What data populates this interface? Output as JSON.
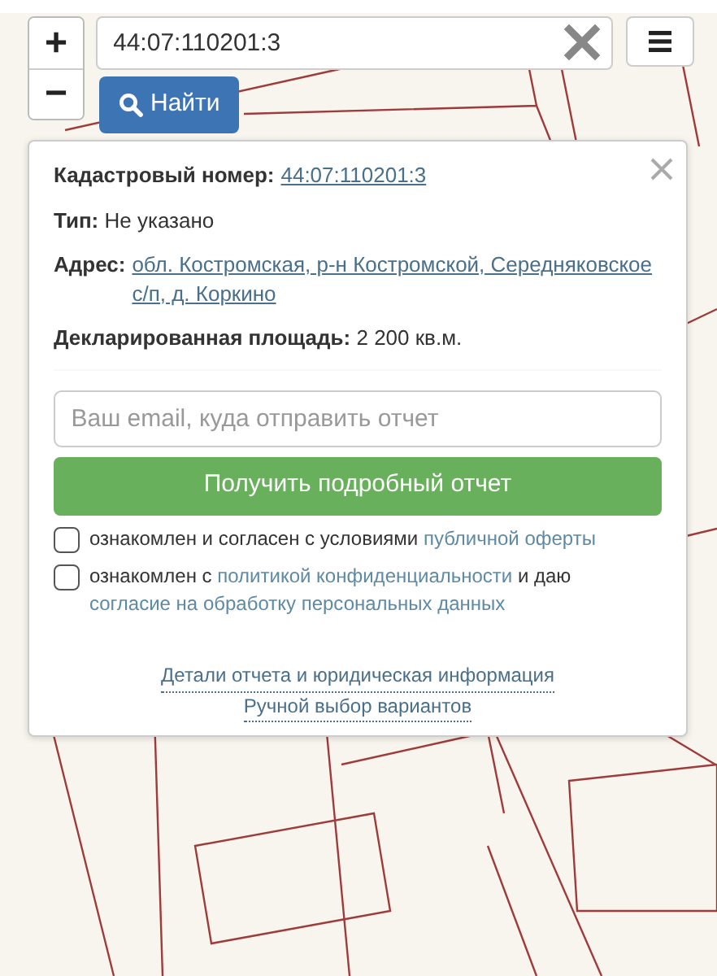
{
  "map_controls": {
    "zoom_in": "+",
    "zoom_out": "−"
  },
  "search": {
    "value": "44:07:110201:3",
    "button": "Найти"
  },
  "popup": {
    "fields": [
      {
        "label": "Кадастровый номер:",
        "value": "44:07:110201:3",
        "link": true
      },
      {
        "label": "Тип:",
        "value": "Не указано",
        "link": false
      },
      {
        "label": "Адрес:",
        "value": "обл. Костромская, р-н Костромской, Середняковское с/п, д. Коркино",
        "link": true
      },
      {
        "label": "Декларированная площадь:",
        "value": "2 200 кв.м.",
        "link": false
      }
    ],
    "email": {
      "placeholder": "Ваш email, куда отправить отчет"
    },
    "submit": "Получить подробный отчет",
    "consents": [
      {
        "checked": false,
        "parts": [
          {
            "text": "ознакомлен и согласен с условиями",
            "link": false
          },
          {
            "text": "публичной оферты",
            "link": true
          }
        ]
      },
      {
        "checked": false,
        "parts": [
          {
            "text": "ознакомлен с",
            "link": false
          },
          {
            "text": "политикой конфиденциальности",
            "link": true
          },
          {
            "text": "и даю",
            "link": false
          },
          {
            "text": "согласие на обработку персональных данных",
            "link": true
          }
        ]
      }
    ],
    "footer_links": [
      "Детали отчета и юридическая информация",
      "Ручной выбор вариантов"
    ]
  }
}
